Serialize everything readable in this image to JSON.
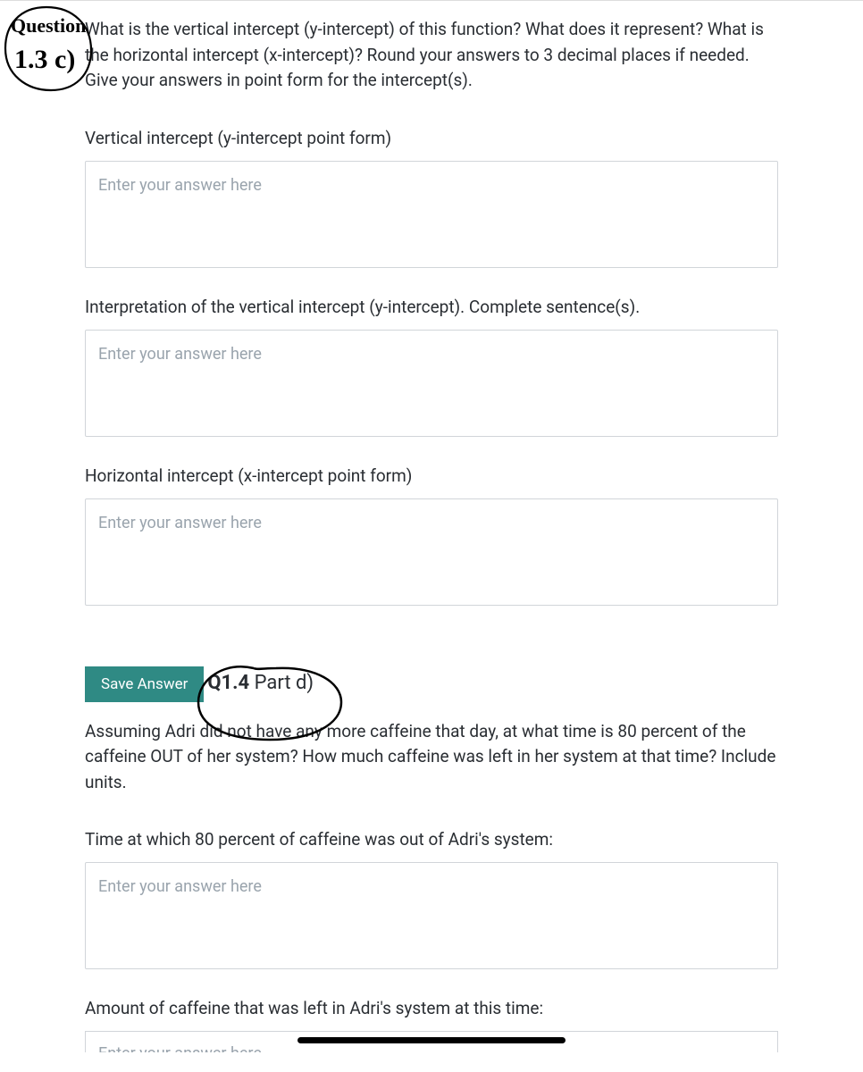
{
  "q13": {
    "prompt": "What is the vertical intercept (y-intercept) of this function? What does it represent? What is the horizontal intercept (x-intercept)? Round your answers to 3 decimal places if needed. Give your answers in point form for the intercept(s).",
    "annotation_top": "Question",
    "annotation_bottom": "1.3 c)",
    "fields": [
      {
        "label": "Vertical intercept (y-intercept point form)",
        "placeholder": "Enter your answer here"
      },
      {
        "label": "Interpretation of the vertical intercept (y-intercept). Complete sentence(s).",
        "placeholder": "Enter your answer here"
      },
      {
        "label": "Horizontal intercept (x-intercept point form)",
        "placeholder": "Enter your answer here"
      }
    ],
    "save_label": "Save Answer"
  },
  "q14": {
    "heading_bold": "Q1.4",
    "heading_part": " Part d)",
    "prompt": "Assuming Adri did not have any more caffeine that day, at what time is 80 percent of the caffeine OUT of her system? How much caffeine was left in her system at that time? Include units.",
    "fields": [
      {
        "label": "Time at which 80 percent of caffeine was out of Adri's system:",
        "placeholder": "Enter your answer here"
      },
      {
        "label": "Amount of caffeine that was left in Adri's system at this time:",
        "placeholder": "Enter your answer here"
      }
    ]
  }
}
